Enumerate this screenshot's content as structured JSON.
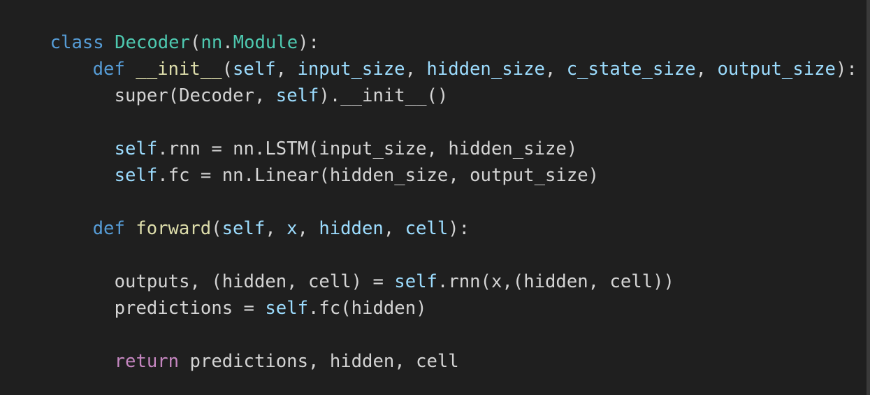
{
  "editor": {
    "lines": [
      {
        "tokens": [
          {
            "text": "class",
            "kind": "keyword"
          },
          {
            "text": " ",
            "kind": "plain"
          },
          {
            "text": "Decoder",
            "kind": "class"
          },
          {
            "text": "(",
            "kind": "punc"
          },
          {
            "text": "nn",
            "kind": "class"
          },
          {
            "text": ".",
            "kind": "punc"
          },
          {
            "text": "Module",
            "kind": "class"
          },
          {
            "text": "):",
            "kind": "punc"
          }
        ]
      },
      {
        "tokens": [
          {
            "text": "def",
            "kind": "keyword"
          },
          {
            "text": " ",
            "kind": "plain"
          },
          {
            "text": "__init__",
            "kind": "function"
          },
          {
            "text": "(",
            "kind": "punc"
          },
          {
            "text": "self",
            "kind": "param"
          },
          {
            "text": ", ",
            "kind": "punc"
          },
          {
            "text": "input_size",
            "kind": "param"
          },
          {
            "text": ", ",
            "kind": "punc"
          },
          {
            "text": "hidden_size",
            "kind": "param"
          },
          {
            "text": ", ",
            "kind": "punc"
          },
          {
            "text": "c_state_size",
            "kind": "param"
          },
          {
            "text": ", ",
            "kind": "punc"
          },
          {
            "text": "output_size",
            "kind": "param"
          },
          {
            "text": "):",
            "kind": "punc"
          }
        ]
      },
      {
        "tokens": [
          {
            "text": "super(Decoder, ",
            "kind": "plain"
          },
          {
            "text": "self",
            "kind": "param"
          },
          {
            "text": ").__init__()",
            "kind": "plain"
          }
        ]
      },
      {
        "tokens": [
          {
            "text": "self",
            "kind": "param"
          },
          {
            "text": ".rnn = nn.LSTM(input_size, hidden_size)",
            "kind": "plain"
          }
        ]
      },
      {
        "tokens": [
          {
            "text": "self",
            "kind": "param"
          },
          {
            "text": ".fc = nn.Linear(hidden_size, output_size)",
            "kind": "plain"
          }
        ]
      },
      {
        "tokens": [
          {
            "text": "def",
            "kind": "keyword"
          },
          {
            "text": " ",
            "kind": "plain"
          },
          {
            "text": "forward",
            "kind": "function"
          },
          {
            "text": "(",
            "kind": "punc"
          },
          {
            "text": "self",
            "kind": "param"
          },
          {
            "text": ", ",
            "kind": "punc"
          },
          {
            "text": "x",
            "kind": "param"
          },
          {
            "text": ", ",
            "kind": "punc"
          },
          {
            "text": "hidden",
            "kind": "param"
          },
          {
            "text": ", ",
            "kind": "punc"
          },
          {
            "text": "cell",
            "kind": "param"
          },
          {
            "text": "):",
            "kind": "punc"
          }
        ]
      },
      {
        "tokens": [
          {
            "text": "outputs, (hidden, cell) = ",
            "kind": "plain"
          },
          {
            "text": "self",
            "kind": "param"
          },
          {
            "text": ".rnn(x,(hidden, cell))",
            "kind": "plain"
          }
        ]
      },
      {
        "tokens": [
          {
            "text": "predictions = ",
            "kind": "plain"
          },
          {
            "text": "self",
            "kind": "param"
          },
          {
            "text": ".fc(hidden)",
            "kind": "plain"
          }
        ]
      },
      {
        "tokens": [
          {
            "text": "return",
            "kind": "control"
          },
          {
            "text": " predictions, hidden, cell",
            "kind": "plain"
          }
        ]
      }
    ]
  },
  "colors": {
    "background": "#1f1f1f",
    "keyword": "#569cd6",
    "control": "#c586c0",
    "class": "#4ec9b0",
    "function": "#dcdcaa",
    "param": "#9cdcfe",
    "plain": "#d4d4d4"
  }
}
